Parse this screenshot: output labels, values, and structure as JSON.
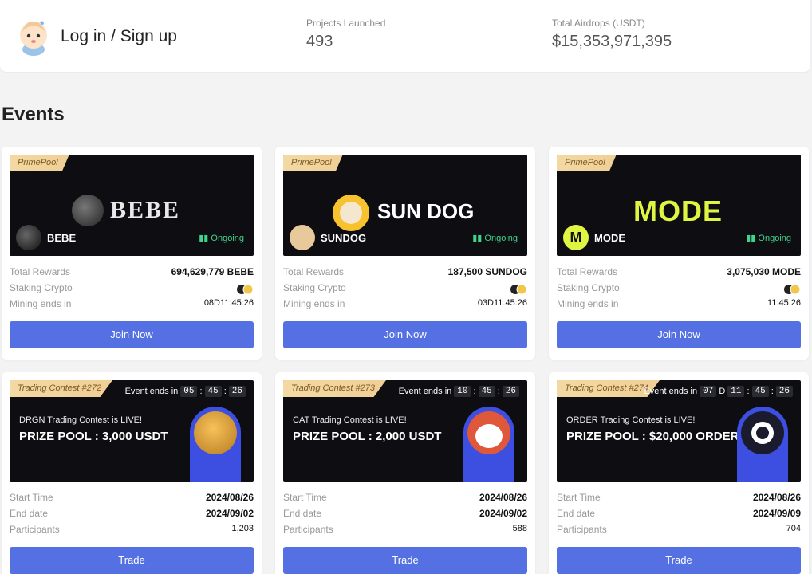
{
  "header": {
    "login_label": "Log in / Sign up",
    "stats": [
      {
        "label": "Projects Launched",
        "value": "493"
      },
      {
        "label": "Total Airdrops (USDT)",
        "value": "$15,353,971,395"
      }
    ]
  },
  "section_title": "Events",
  "labels": {
    "total_rewards": "Total Rewards",
    "staking_crypto": "Staking Crypto",
    "mining_ends": "Mining ends in",
    "join": "Join Now",
    "start_time": "Start Time",
    "end_date": "End date",
    "participants": "Participants",
    "trade": "Trade",
    "event_ends": "Event ends in",
    "ongoing": "Ongoing"
  },
  "pools": [
    {
      "tag": "PrimePool",
      "banner_text": "BEBE",
      "coin": "BEBE",
      "total_rewards": "694,629,779 BEBE",
      "mining_ends": "08D11:45:26",
      "banner_color": "#e8e8e8"
    },
    {
      "tag": "PrimePool",
      "banner_text": "SUN DOG",
      "coin": "SUNDOG",
      "total_rewards": "187,500 SUNDOG",
      "mining_ends": "03D11:45:26",
      "banner_color": "#ffffff"
    },
    {
      "tag": "PrimePool",
      "banner_text": "MODE",
      "coin": "MODE",
      "total_rewards": "3,075,030 MODE",
      "mining_ends": "11:45:26",
      "banner_color": "#dff542"
    }
  ],
  "contests": [
    {
      "tag": "Trading Contest #272",
      "countdown": [
        "05",
        "45",
        "26"
      ],
      "days": "",
      "line": "DRGN  Trading Contest is LIVE!",
      "prize": "PRIZE POOL : 3,000 USDT",
      "start": "2024/08/26",
      "end": "2024/09/02",
      "participants": "1,203"
    },
    {
      "tag": "Trading Contest #273",
      "countdown": [
        "10",
        "45",
        "26"
      ],
      "days": "",
      "line": "CAT  Trading Contest is LIVE!",
      "prize": "PRIZE POOL : 2,000 USDT",
      "start": "2024/08/26",
      "end": "2024/09/02",
      "participants": "588"
    },
    {
      "tag": "Trading Contest #274",
      "countdown": [
        "11",
        "45",
        "26"
      ],
      "days": "07",
      "line": "ORDER  Trading Contest is LIVE!",
      "prize": "PRIZE POOL : $20,000 ORDER",
      "start": "2024/08/26",
      "end": "2024/09/09",
      "participants": "704"
    }
  ]
}
